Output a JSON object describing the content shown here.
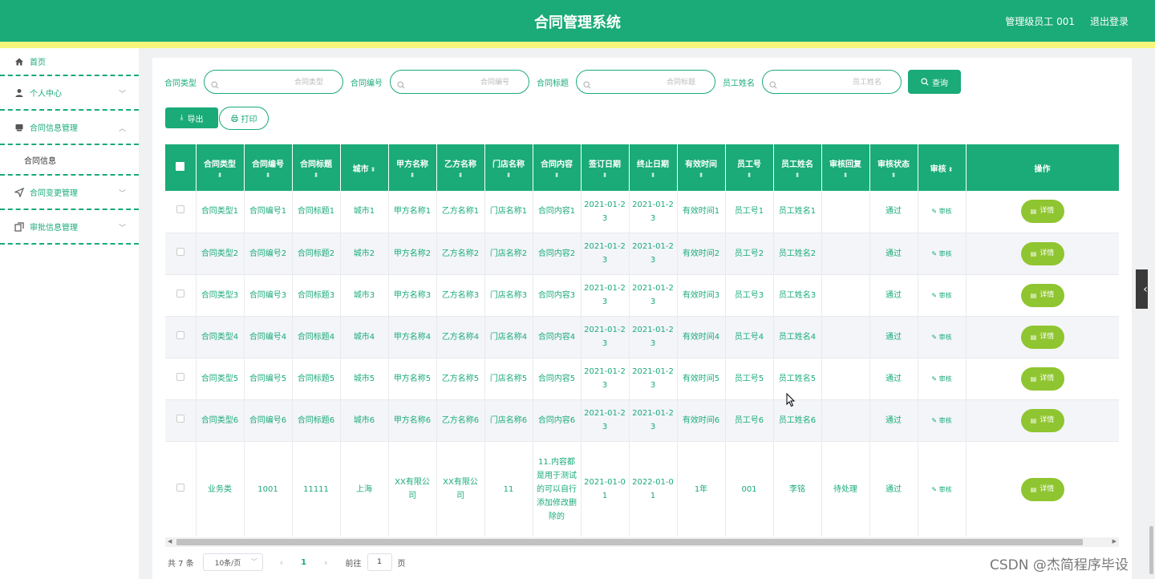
{
  "header": {
    "title": "合同管理系统",
    "user": "管理级员工 001",
    "logout": "退出登录"
  },
  "sidebar": {
    "items": [
      {
        "label": "首页",
        "icon": "home-icon"
      },
      {
        "label": "个人中心",
        "icon": "user-icon"
      },
      {
        "label": "合同信息管理",
        "icon": "contract-icon",
        "expanded": true,
        "sub": "合同信息"
      },
      {
        "label": "合同变更管理",
        "icon": "send-icon"
      },
      {
        "label": "审批信息管理",
        "icon": "copy-icon"
      }
    ]
  },
  "search": {
    "fields": [
      {
        "label": "合同类型",
        "placeholder": "合同类型"
      },
      {
        "label": "合同编号",
        "placeholder": "合同编号"
      },
      {
        "label": "合同标题",
        "placeholder": "合同标题"
      },
      {
        "label": "员工姓名",
        "placeholder": "员工姓名"
      }
    ],
    "query_button": "查询"
  },
  "toolbar": {
    "export_label": "导出",
    "print_label": "打印"
  },
  "table": {
    "headers": [
      "合同类型",
      "合同编号",
      "合同标题",
      "城市",
      "甲方名称",
      "乙方名称",
      "门店名称",
      "合同内容",
      "签订日期",
      "终止日期",
      "有效时间",
      "员工号",
      "员工姓名",
      "审核回复",
      "审核状态",
      "审核",
      "操作"
    ],
    "audit_label": "审核",
    "detail_label": "详情",
    "rows": [
      [
        "合同类型1",
        "合同编号1",
        "合同标题1",
        "城市1",
        "甲方名称1",
        "乙方名称1",
        "门店名称1",
        "合同内容1",
        "2021-01-23",
        "2021-01-23",
        "有效时间1",
        "员工号1",
        "员工姓名1",
        "",
        "通过"
      ],
      [
        "合同类型2",
        "合同编号2",
        "合同标题2",
        "城市2",
        "甲方名称2",
        "乙方名称2",
        "门店名称2",
        "合同内容2",
        "2021-01-23",
        "2021-01-23",
        "有效时间2",
        "员工号2",
        "员工姓名2",
        "",
        "通过"
      ],
      [
        "合同类型3",
        "合同编号3",
        "合同标题3",
        "城市3",
        "甲方名称3",
        "乙方名称3",
        "门店名称3",
        "合同内容3",
        "2021-01-23",
        "2021-01-23",
        "有效时间3",
        "员工号3",
        "员工姓名3",
        "",
        "通过"
      ],
      [
        "合同类型4",
        "合同编号4",
        "合同标题4",
        "城市4",
        "甲方名称4",
        "乙方名称4",
        "门店名称4",
        "合同内容4",
        "2021-01-23",
        "2021-01-23",
        "有效时间4",
        "员工号4",
        "员工姓名4",
        "",
        "通过"
      ],
      [
        "合同类型5",
        "合同编号5",
        "合同标题5",
        "城市5",
        "甲方名称5",
        "乙方名称5",
        "门店名称5",
        "合同内容5",
        "2021-01-23",
        "2021-01-23",
        "有效时间5",
        "员工号5",
        "员工姓名5",
        "",
        "通过"
      ],
      [
        "合同类型6",
        "合同编号6",
        "合同标题6",
        "城市6",
        "甲方名称6",
        "乙方名称6",
        "门店名称6",
        "合同内容6",
        "2021-01-23",
        "2021-01-23",
        "有效时间6",
        "员工号6",
        "员工姓名6",
        "",
        "通过"
      ],
      [
        "业务类",
        "1001",
        "11111",
        "上海",
        "XX有限公司",
        "XX有限公司",
        "11",
        "11.内容都是用于测试的可以自行添加修改删除的",
        "2021-01-01",
        "2022-01-01",
        "1年",
        "001",
        "李铭",
        "待处理",
        "通过"
      ]
    ]
  },
  "pagination": {
    "total": "共 7 条",
    "page_size": "10条/页",
    "current_page": "1",
    "goto_label": "前往",
    "goto_value": "1",
    "page_suffix": "页"
  },
  "watermark": "CSDN @杰简程序毕设",
  "colors": {
    "primary": "#1aab78",
    "accent_yellow": "#f6f67a",
    "detail_button": "#8fc530"
  }
}
